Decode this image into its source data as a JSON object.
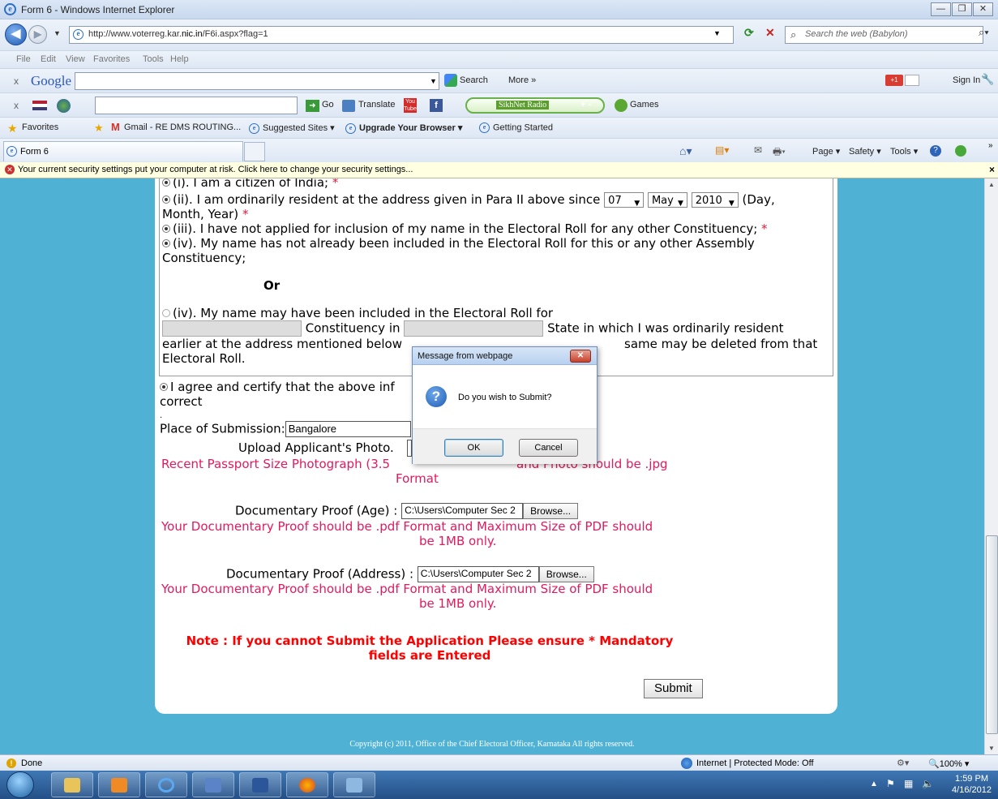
{
  "window": {
    "title": "Form 6 - Windows Internet Explorer",
    "controls": [
      "min-icon",
      "restore-icon",
      "close-icon"
    ]
  },
  "address": {
    "url_prefix": "http://www.voterreg.kar.",
    "url_domain": "nic.in",
    "url_path": "/F6i.aspx?flag=1",
    "search_placeholder": "Search the web (Babylon)"
  },
  "menu": [
    "File",
    "Edit",
    "View",
    "Favorites",
    "Tools",
    "Help"
  ],
  "google_toolbar": {
    "brand": "Google",
    "search_label": "Search",
    "more_label": "More »",
    "signin_label": "Sign In",
    "gplus": "+1"
  },
  "babylon_toolbar": {
    "go_label": "Go",
    "translate_label": "Translate",
    "radio_label": "SikhNet Radio",
    "games_label": "Games"
  },
  "favorites": {
    "label": "Favorites",
    "items": [
      "Gmail - RE DMS ROUTING...",
      "Suggested Sites ▾",
      "Upgrade Your Browser ▾",
      "Getting Started"
    ]
  },
  "tab": {
    "label": "Form 6"
  },
  "command_bar": {
    "page": "Page ▾",
    "safety": "Safety ▾",
    "tools": "Tools ▾"
  },
  "infobar": {
    "text": "Your current security settings put your computer at risk. Click here to change your security settings..."
  },
  "form": {
    "item_i": "(i). I am a citizen of India;",
    "item_ii_a": "(ii). I am ordinarily resident at the address given in Para II above since",
    "day": "07",
    "month": "May",
    "year": "2010",
    "item_ii_b": "(Day,",
    "item_ii_c": "Month, Year)",
    "item_iii": "(iii). I have not applied for inclusion of my name in the Electoral Roll for any other Constituency;",
    "item_iv": "(iv). My name has not already been included in the Electoral Roll for this or any other Assembly",
    "item_iv_b": "Constituency;",
    "or": "Or",
    "alt_iv": "(iv). My name may have been included in the Electoral Roll for",
    "constituency_in": "Constituency in",
    "state_text": "State in which I was ordinarily resident",
    "earlier_a": "earlier at the address mentioned below",
    "earlier_b": "same may be deleted from that",
    "electoral_roll": "Electoral Roll.",
    "agree_a": "I agree and certify that the above inf",
    "agree_b": "correct",
    "dot": ".",
    "place_label": "Place of Submission:",
    "place_value": "Bangalore",
    "photo_label": "Upload Applicant's Photo.",
    "photo_note_a": "Recent Passport Size Photograph (3.5",
    "photo_note_b": "Format",
    "photo_note_c": "and Photo should be .jpg",
    "age_label": "Documentary Proof (Age) :",
    "age_value": "C:\\Users\\Computer Sec 2",
    "browse": "Browse...",
    "pdf_note_a": "Your Documentary Proof should be .pdf Format and Maximum Size of PDF should",
    "pdf_note_b": "be 1MB only.",
    "addr_label": "Documentary Proof (Address) :",
    "addr_value": "C:\\Users\\Computer Sec 2",
    "note_a": "Note : If you cannot Submit the Application Please ensure * Mandatory",
    "note_b": "fields are Entered",
    "submit": "Submit",
    "star": "*"
  },
  "footer": "Copyright (c) 2011, Office of the Chief Electoral Officer, Karnataka All rights reserved.",
  "dialog": {
    "title": "Message from webpage",
    "message": "Do you wish to Submit?",
    "ok": "OK",
    "cancel": "Cancel"
  },
  "status": {
    "text": "Done",
    "zone": "Internet | Protected Mode: Off",
    "zoom": "100%"
  },
  "taskbar": {
    "time": "1:59 PM",
    "date": "4/16/2012"
  },
  "colors": {
    "page_bg": "#4fb2d5",
    "red": "#ff0000",
    "pink": "#e21a5c"
  }
}
